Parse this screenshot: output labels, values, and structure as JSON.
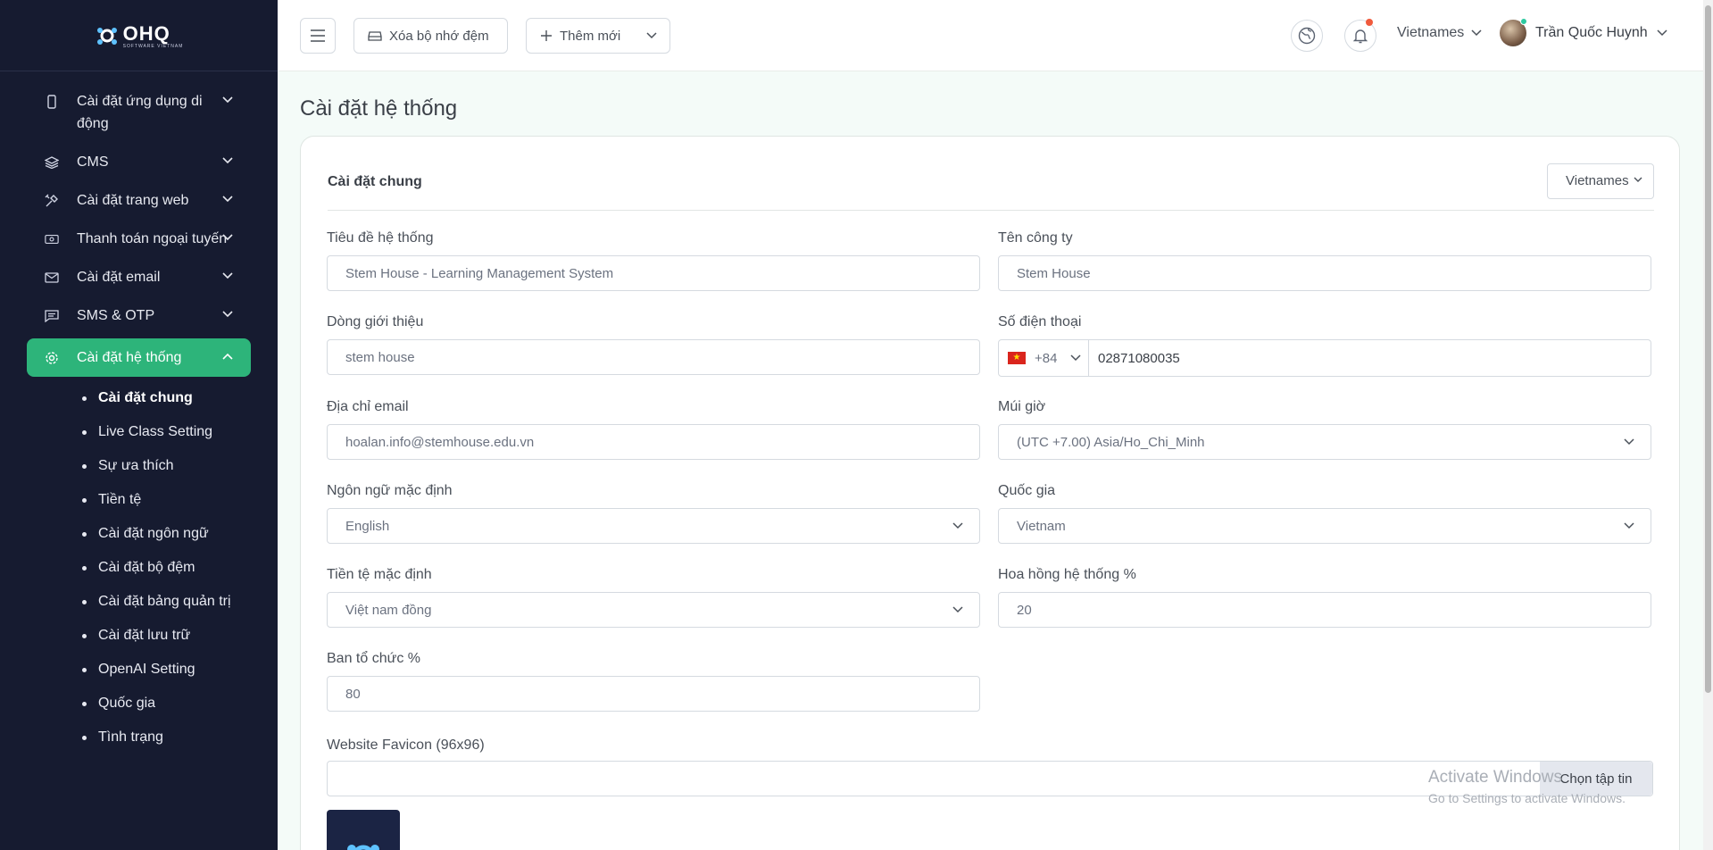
{
  "brand": {
    "name": "OHQ",
    "tagline": "SOFTWARE VIETNAM"
  },
  "sidebar": {
    "items": [
      {
        "label": "Cài đặt ứng dụng di động",
        "icon": "mobile-icon"
      },
      {
        "label": "CMS",
        "icon": "layers-icon"
      },
      {
        "label": "Cài đặt trang web",
        "icon": "tools-icon"
      },
      {
        "label": "Thanh toán ngoại tuyến",
        "icon": "cash-icon"
      },
      {
        "label": "Cài đặt email",
        "icon": "mail-icon"
      },
      {
        "label": "SMS & OTP",
        "icon": "message-icon"
      },
      {
        "label": "Cài đặt hệ thống",
        "icon": "gear-icon",
        "active": true
      }
    ],
    "subitems": [
      "Cài đặt chung",
      "Live Class Setting",
      "Sự ưa thích",
      "Tiền tệ",
      "Cài đặt ngôn ngữ",
      "Cài đặt bộ đệm",
      "Cài đặt bảng quản trị",
      "Cài đặt lưu trữ",
      "OpenAI Setting",
      "Quốc gia",
      "Tình trạng"
    ]
  },
  "header": {
    "clear_cache": "Xóa bộ nhớ đệm",
    "add_new": "Thêm mới",
    "language": "Vietnames",
    "user_name": "Trần Quốc Huynh"
  },
  "page": {
    "title": "Cài đặt hệ thống",
    "card_title": "Cài đặt chung",
    "card_language": "Vietnames"
  },
  "form": {
    "system_title": {
      "label": "Tiêu đề hệ thống",
      "value": "Stem House - Learning Management System"
    },
    "company_name": {
      "label": "Tên công ty",
      "value": "Stem House"
    },
    "tagline": {
      "label": "Dòng giới thiệu",
      "value": "stem house"
    },
    "phone": {
      "label": "Số điện thoại",
      "country_code": "+84",
      "value": "02871080035"
    },
    "email": {
      "label": "Địa chỉ email",
      "value": "hoalan.info@stemhouse.edu.vn"
    },
    "timezone": {
      "label": "Múi giờ",
      "value": "(UTC +7.00) Asia/Ho_Chi_Minh"
    },
    "default_language": {
      "label": "Ngôn ngữ mặc định",
      "value": "English"
    },
    "country": {
      "label": "Quốc gia",
      "value": "Vietnam"
    },
    "default_currency": {
      "label": "Tiền tệ mặc định",
      "value": "Việt nam đồng"
    },
    "commission": {
      "label": "Hoa hồng hệ thống %",
      "value": "20"
    },
    "organizer": {
      "label": "Ban tổ chức %",
      "value": "80"
    },
    "favicon": {
      "label": "Website Favicon (96x96)",
      "button": "Chọn tập tin"
    }
  },
  "watermark": {
    "line1": "Activate Windows",
    "line2": "Go to Settings to activate Windows."
  },
  "colors": {
    "sidebar_bg": "#161b30",
    "accent": "#2db47a",
    "notification_dot": "#f05a3c"
  }
}
